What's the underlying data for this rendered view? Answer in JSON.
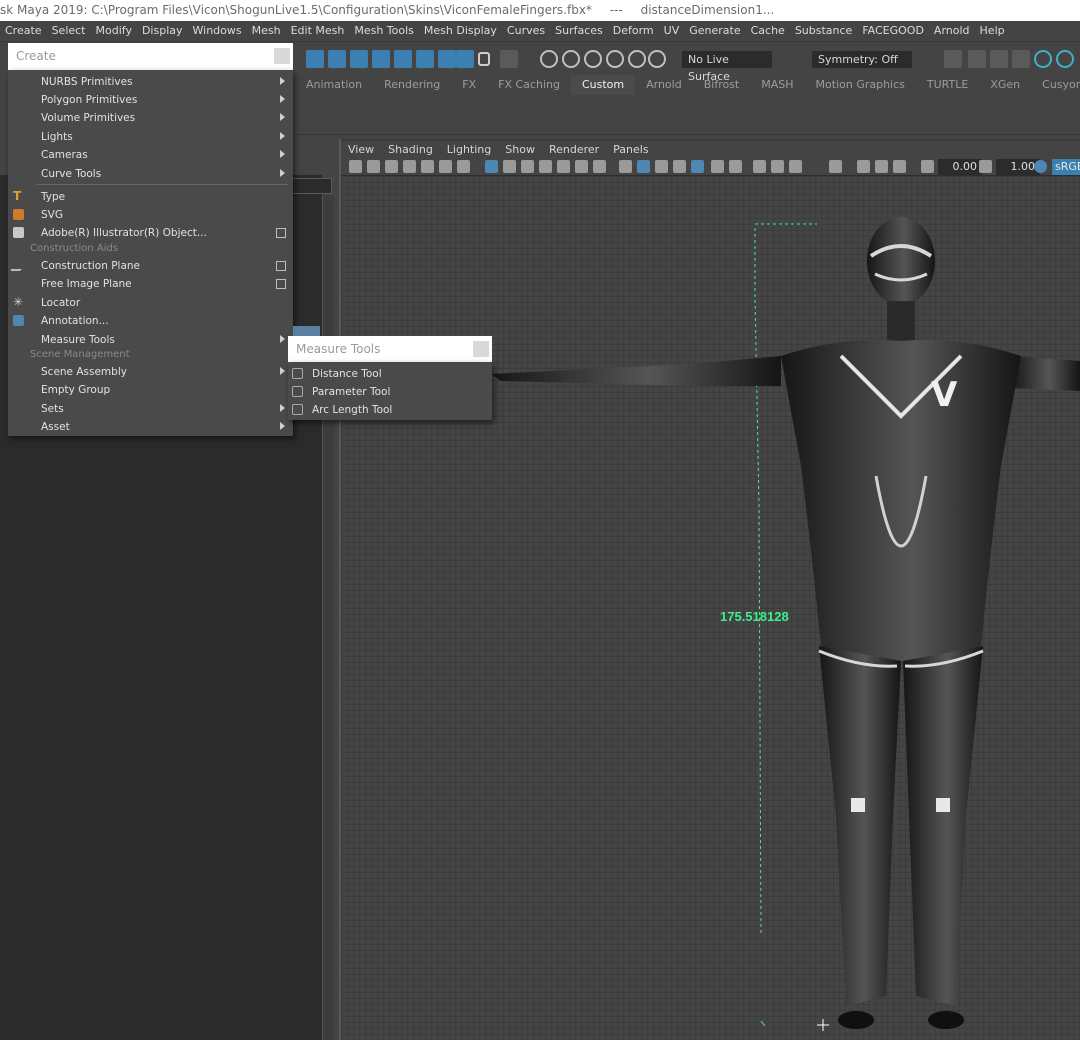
{
  "titlebar": {
    "text": "sk Maya 2019: C:\\Program Files\\Vicon\\ShogunLive1.5\\Configuration\\Skins\\ViconFemaleFingers.fbx*",
    "separator": "---",
    "node": "distanceDimension1..."
  },
  "menubar": [
    "Create",
    "Select",
    "Modify",
    "Display",
    "Windows",
    "Mesh",
    "Edit Mesh",
    "Mesh Tools",
    "Mesh Display",
    "Curves",
    "Surfaces",
    "Deform",
    "UV",
    "Generate",
    "Cache",
    "Substance",
    "FACEGOOD",
    "Arnold",
    "Help"
  ],
  "statusline": {
    "live_surface": "No Live Surface",
    "symmetry": "Symmetry: Off"
  },
  "shelf_tabs": [
    "Animation",
    "Rendering",
    "FX",
    "FX Caching",
    "Custom",
    "Arnold",
    "Bifrost",
    "MASH",
    "Motion Graphics",
    "TURTLE",
    "XGen",
    "Cusyom"
  ],
  "shelf_active": "Custom",
  "create_menu": {
    "title": "Create",
    "items": [
      {
        "label": "NURBS Primitives",
        "arrow": true
      },
      {
        "label": "Polygon Primitives",
        "arrow": true
      },
      {
        "label": "Volume Primitives",
        "arrow": true
      },
      {
        "label": "Lights",
        "arrow": true
      },
      {
        "label": "Cameras",
        "arrow": true
      },
      {
        "label": "Curve Tools",
        "arrow": true
      },
      {
        "label": "Type"
      },
      {
        "label": "SVG"
      },
      {
        "label": "Adobe(R) Illustrator(R) Object...",
        "option": true
      },
      {
        "label": "Construction Plane",
        "option": true
      },
      {
        "label": "Free Image Plane",
        "option": true
      },
      {
        "label": "Locator"
      },
      {
        "label": "Annotation..."
      },
      {
        "label": "Measure Tools",
        "arrow": true
      },
      {
        "label": "Scene Assembly",
        "arrow": true
      },
      {
        "label": "Empty Group"
      },
      {
        "label": "Sets",
        "arrow": true
      },
      {
        "label": "Asset",
        "arrow": true
      }
    ],
    "sections": {
      "construction_aids": "Construction Aids",
      "scene_management": "Scene Management"
    }
  },
  "measure_menu": {
    "title": "Measure Tools",
    "items": [
      "Distance Tool",
      "Parameter Tool",
      "Arc Length Tool"
    ]
  },
  "viewport": {
    "menu": [
      "View",
      "Shading",
      "Lighting",
      "Show",
      "Renderer",
      "Panels"
    ],
    "exposure": "0.00",
    "gamma": "1.00",
    "color_space": "sRGB",
    "distance_value": "175.518128"
  },
  "colors": {
    "accent": "#5b7fa0",
    "measure_line": "#3ef08e"
  }
}
